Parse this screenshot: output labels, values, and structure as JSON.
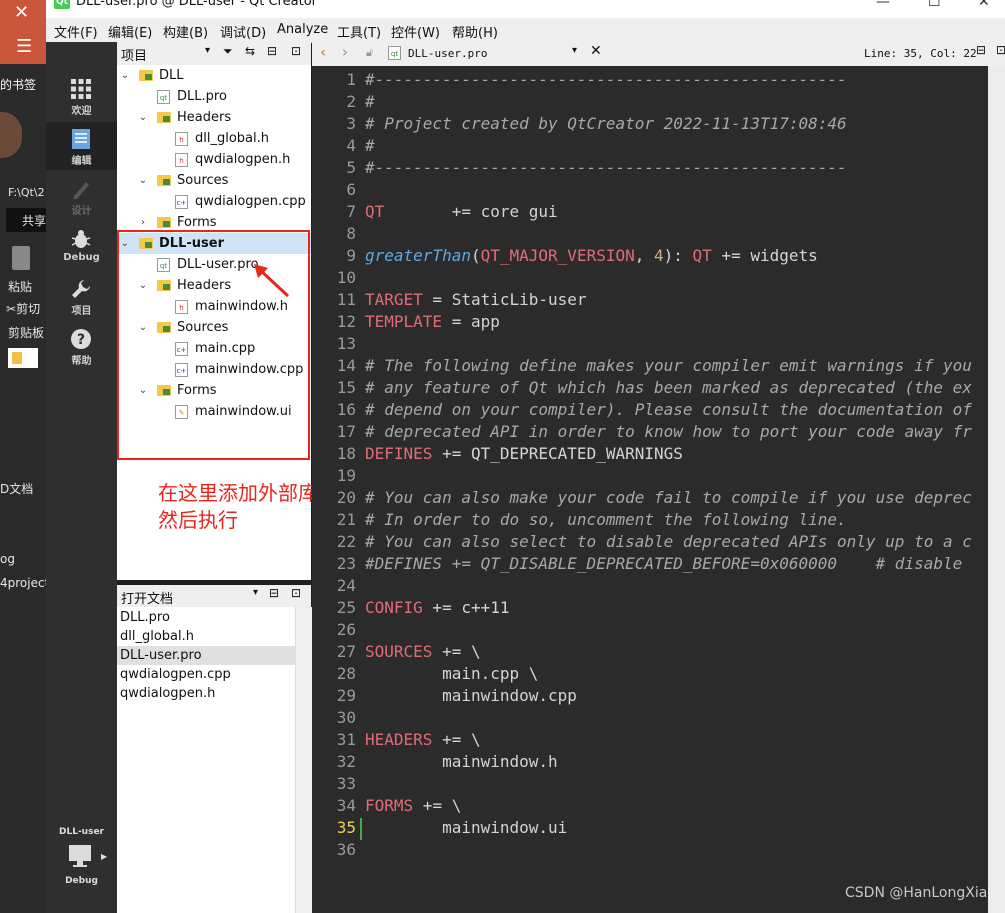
{
  "background_app": {
    "left_texts": [
      "的书签",
      "F:\\Qt\\2",
      "共享",
      "粘贴",
      "剪切",
      "剪贴板",
      "D文档",
      "og",
      "4project"
    ]
  },
  "titlebar": {
    "title": "DLL-user.pro @ DLL-user - Qt Creator",
    "app_icon": "Qt"
  },
  "menu": [
    "文件(F)",
    "编辑(E)",
    "构建(B)",
    "调试(D)",
    "Analyze",
    "工具(T)",
    "控件(W)",
    "帮助(H)"
  ],
  "modes": [
    {
      "label": "欢迎",
      "icon": "grid-icon"
    },
    {
      "label": "编辑",
      "icon": "document-icon"
    },
    {
      "label": "设计",
      "icon": "pencil-icon"
    },
    {
      "label": "Debug",
      "icon": "bug-icon"
    },
    {
      "label": "项目",
      "icon": "wrench-icon"
    },
    {
      "label": "帮助",
      "icon": "help-icon"
    }
  ],
  "kit": {
    "project": "DLL-user",
    "config": "Debug"
  },
  "project_panel": {
    "title": "项目",
    "tree": [
      {
        "label": "DLL",
        "kind": "project"
      },
      {
        "label": "DLL.pro",
        "kind": "pro"
      },
      {
        "label": "Headers",
        "kind": "folder"
      },
      {
        "label": "dll_global.h",
        "kind": "header"
      },
      {
        "label": "qwdialogpen.h",
        "kind": "header"
      },
      {
        "label": "Sources",
        "kind": "folder"
      },
      {
        "label": "qwdialogpen.cpp",
        "kind": "source"
      },
      {
        "label": "Forms",
        "kind": "folder"
      },
      {
        "label": "DLL-user",
        "kind": "project"
      },
      {
        "label": "DLL-user.pro",
        "kind": "pro"
      },
      {
        "label": "Headers",
        "kind": "folder"
      },
      {
        "label": "mainwindow.h",
        "kind": "header"
      },
      {
        "label": "Sources",
        "kind": "folder"
      },
      {
        "label": "main.cpp",
        "kind": "source"
      },
      {
        "label": "mainwindow.cpp",
        "kind": "source"
      },
      {
        "label": "Forms",
        "kind": "folder"
      },
      {
        "label": "mainwindow.ui",
        "kind": "form"
      }
    ]
  },
  "annotation": {
    "line1": "在这里添加外部库",
    "line2": "然后执行"
  },
  "open_docs": {
    "title": "打开文档",
    "items": [
      "DLL.pro",
      "dll_global.h",
      "DLL-user.pro",
      "qwdialogpen.cpp",
      "qwdialogpen.h"
    ],
    "selected": "DLL-user.pro"
  },
  "editor": {
    "file": "DLL-user.pro",
    "position": "Line: 35, Col: 22",
    "current_line": 35,
    "lines": [
      "#-------------------------------------------------",
      "#",
      "# Project created by QtCreator 2022-11-13T17:08:46",
      "#",
      "#-------------------------------------------------",
      "",
      "QT       += core gui",
      "",
      "greaterThan(QT_MAJOR_VERSION, 4): QT += widgets",
      "",
      "TARGET = StaticLib-user",
      "TEMPLATE = app",
      "",
      "# The following define makes your compiler emit warnings if you",
      "# any feature of Qt which has been marked as deprecated (the ex",
      "# depend on your compiler). Please consult the documentation of",
      "# deprecated API in order to know how to port your code away fr",
      "DEFINES += QT_DEPRECATED_WARNINGS",
      "",
      "# You can also make your code fail to compile if you use deprec",
      "# In order to do so, uncomment the following line.",
      "# You can also select to disable deprecated APIs only up to a c",
      "#DEFINES += QT_DISABLE_DEPRECATED_BEFORE=0x060000    # disable",
      "",
      "CONFIG += c++11",
      "",
      "SOURCES += \\",
      "        main.cpp \\",
      "        mainwindow.cpp",
      "",
      "HEADERS += \\",
      "        mainwindow.h",
      "",
      "FORMS += \\",
      "        mainwindow.ui",
      ""
    ]
  },
  "watermark": "CSDN @HanLongXia"
}
